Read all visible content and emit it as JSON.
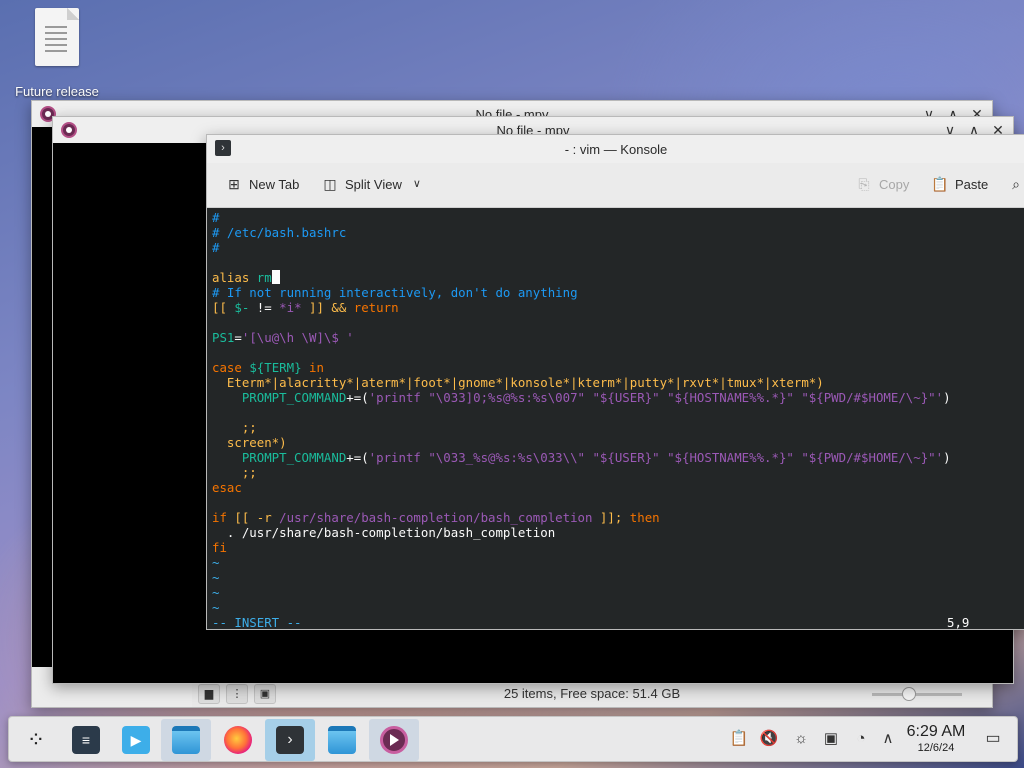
{
  "desktop": {
    "icon_label": "Future release",
    "icon_name": "text-document-icon"
  },
  "mpv_back": {
    "title": "No file - mpv",
    "status": "25 items, Free space: 51.4 GB"
  },
  "mpv_front": {
    "title": "No file - mpv"
  },
  "window_buttons": {
    "minimize": "∨",
    "maximize": "∧",
    "close": "✕"
  },
  "konsole": {
    "title": "- : vim — Konsole",
    "toolbar": {
      "new_tab": "New Tab",
      "split_view": "Split View",
      "copy": "Copy",
      "paste": "Paste"
    },
    "terminal_bg": "#232627",
    "lines": [
      [
        {
          "t": "#",
          "c": "comment"
        }
      ],
      [
        {
          "t": "# /etc/bash.bashrc",
          "c": "comment"
        }
      ],
      [
        {
          "t": "#",
          "c": "comment"
        }
      ],
      [],
      [
        {
          "t": "alias ",
          "c": "yellow"
        },
        {
          "t": "rm",
          "c": "ident"
        }
      ],
      [
        {
          "t": "# If not running interactively, don't do anything",
          "c": "comment"
        }
      ],
      [
        {
          "t": "[[ ",
          "c": "yellow"
        },
        {
          "t": "$-",
          "c": "ident"
        },
        {
          "t": " != ",
          "c": "plain"
        },
        {
          "t": "*i*",
          "c": "string"
        },
        {
          "t": " ]] && ",
          "c": "yellow"
        },
        {
          "t": "return",
          "c": "keyword"
        }
      ],
      [],
      [
        {
          "t": "PS1",
          "c": "ident"
        },
        {
          "t": "=",
          "c": "plain"
        },
        {
          "t": "'[\\u@\\h \\W]\\$ '",
          "c": "string"
        }
      ],
      [],
      [
        {
          "t": "case ",
          "c": "keyword"
        },
        {
          "t": "${TERM}",
          "c": "ident"
        },
        {
          "t": " in",
          "c": "keyword"
        }
      ],
      [
        {
          "t": "  Eterm*|alacritty*|aterm*|foot*|gnome*|konsole*|kterm*|putty*|rxvt*|tmux*|xterm*)",
          "c": "yellow"
        }
      ],
      [
        {
          "t": "    PROMPT_COMMAND",
          "c": "ident"
        },
        {
          "t": "+=(",
          "c": "plain"
        },
        {
          "t": "'printf \"\\033]0;%s@%s:%s\\007\" \"${USER}\" \"${HOSTNAME%%.*}\" \"${PWD/#$HOME/\\~}\"'",
          "c": "string"
        },
        {
          "t": ")",
          "c": "plain"
        }
      ],
      [],
      [
        {
          "t": "    ;;",
          "c": "yellow"
        }
      ],
      [
        {
          "t": "  screen*)",
          "c": "yellow"
        }
      ],
      [
        {
          "t": "    PROMPT_COMMAND",
          "c": "ident"
        },
        {
          "t": "+=(",
          "c": "plain"
        },
        {
          "t": "'printf \"\\033_%s@%s:%s\\033\\\\\" \"${USER}\" \"${HOSTNAME%%.*}\" \"${PWD/#$HOME/\\~}\"'",
          "c": "string"
        },
        {
          "t": ")",
          "c": "plain"
        }
      ],
      [
        {
          "t": "    ;;",
          "c": "yellow"
        }
      ],
      [
        {
          "t": "esac",
          "c": "keyword"
        }
      ],
      [],
      [
        {
          "t": "if ",
          "c": "keyword"
        },
        {
          "t": "[[ -r ",
          "c": "yellow"
        },
        {
          "t": "/usr/share/bash-completion/bash_completion",
          "c": "string"
        },
        {
          "t": " ]]; ",
          "c": "yellow"
        },
        {
          "t": "then",
          "c": "keyword"
        }
      ],
      [
        {
          "t": "  . /usr/share/bash-completion/bash_completion",
          "c": "plain"
        }
      ],
      [
        {
          "t": "fi",
          "c": "keyword"
        }
      ],
      [
        {
          "t": "~",
          "c": "tilde"
        }
      ],
      [
        {
          "t": "~",
          "c": "tilde"
        }
      ],
      [
        {
          "t": "~",
          "c": "tilde"
        }
      ],
      [
        {
          "t": "~",
          "c": "tilde"
        }
      ]
    ],
    "mode": "-- INSERT --",
    "position": "5,9"
  },
  "taskbar": {
    "items": [
      {
        "name": "application-launcher"
      },
      {
        "name": "system-settings"
      },
      {
        "name": "discover"
      },
      {
        "name": "dolphin-file-manager"
      },
      {
        "name": "firefox"
      },
      {
        "name": "konsole"
      },
      {
        "name": "dolphin-file-manager-2"
      },
      {
        "name": "mpv"
      }
    ],
    "clock_time": "6:29 AM",
    "clock_date": "12/6/24"
  }
}
